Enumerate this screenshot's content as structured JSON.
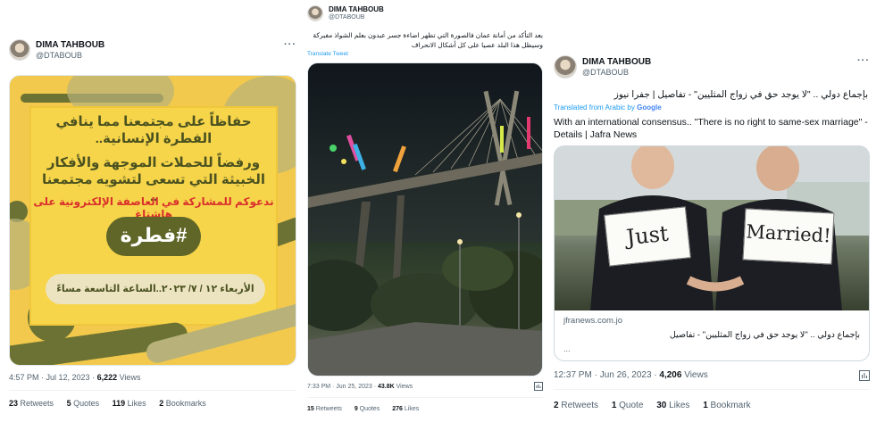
{
  "tweets": [
    {
      "name": "DIMA TAHBOUB",
      "handle": "@DTABOUB",
      "more": "···",
      "poster": {
        "line1": "حفاظاً على مجتمعنا مما ينافي الفطرة الإنسانية..",
        "line2": "ورفضاً للحملات الموجهة والأفكار الخبيثة التي تسعى لتشويه مجتمعنا ..",
        "line3": "ندعوكم للمشاركة في العاصفة الإلكترونية على هاشتاغ",
        "hashtag": "#فطرة",
        "date": "الأربعاء ١٢ / ٧/ ٢٠٢٣..الساعة التاسعة مساءً"
      },
      "time": "4:57 PM · Jul 12, 2023 · ",
      "views": "6,222",
      "views_label": " Views",
      "retweets": "23",
      "retweets_label": " Retweets",
      "quotes": "5",
      "quotes_label": " Quotes",
      "likes": "119",
      "likes_label": " Likes",
      "bookmarks": "2",
      "bookmarks_label": " Bookmarks"
    },
    {
      "name": "DIMA TAHBOUB",
      "handle": "@DTABOUB",
      "text": "بعد التأكد من أمانة عمان فالصورة التي تظهر اضاءة جسر عبدون بعلم الشواذ مفبركة وسيظل هذا البلد عصيا على كل أشكال الانحراف",
      "translate": "Translate Tweet",
      "time": "7:33 PM · Jun 25, 2023 · ",
      "views": "43.8K",
      "views_label": " Views",
      "retweets": "15",
      "retweets_label": " Retweets",
      "quotes": "9",
      "quotes_label": " Quotes",
      "likes": "276",
      "likes_label": " Likes"
    },
    {
      "name": "DIMA TAHBOUB",
      "handle": "@DTABOUB",
      "more": "···",
      "text": "بإجماع دولي .. \"لا يوجد حق في زواج المثليين\" - تفاصيل | جفرا نيوز",
      "translated_from": "Translated from Arabic by",
      "google": "Google",
      "translation": "With an international consensus.. \"There is no right to same-sex marriage\" - Details | Jafra News",
      "sign_left": "Just",
      "sign_right": "Married!",
      "card_domain": "jfranews.com.jo",
      "card_title": "بإجماع دولي .. \"لا يوجد حق في زواج المثليين\" - تفاصيل",
      "card_more": "...",
      "time": "12:37 PM · Jun 26, 2023 · ",
      "views": "4,206",
      "views_label": " Views",
      "retweets": "2",
      "retweets_label": " Retweets",
      "quotes": "1",
      "quotes_label": " Quote",
      "likes": "30",
      "likes_label": " Likes",
      "bookmarks": "1",
      "bookmarks_label": " Bookmark"
    }
  ],
  "colors": {
    "accent": "#1d9bf0",
    "poster_yellow": "#f2c94c",
    "poster_green": "#6b7233"
  }
}
